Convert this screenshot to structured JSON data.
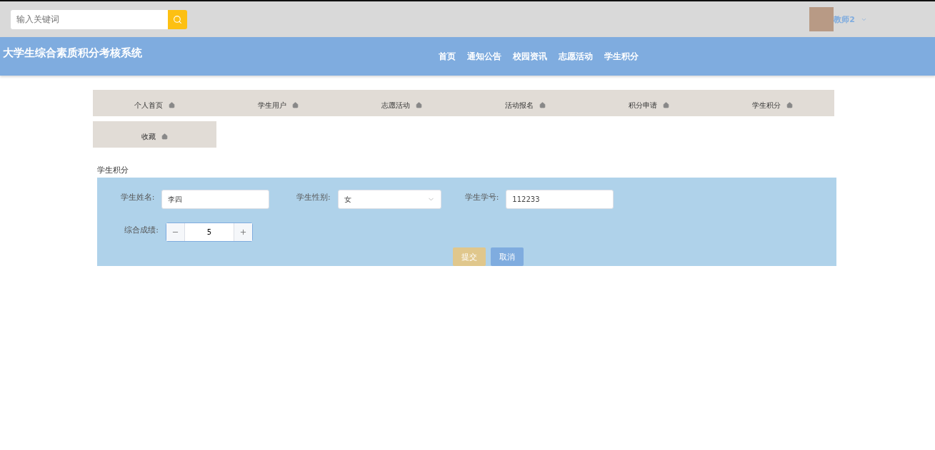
{
  "search": {
    "placeholder": "输入关键词"
  },
  "user": {
    "name": "教师2"
  },
  "header": {
    "title": "大学生综合素质积分考核系统",
    "nav": [
      "首页",
      "通知公告",
      "校园资讯",
      "志愿活动",
      "学生积分"
    ]
  },
  "menu": [
    "个人首页",
    "学生用户",
    "志愿活动",
    "活动报名",
    "积分申请",
    "学生积分",
    "收藏"
  ],
  "section_title": "学生积分",
  "form": {
    "fields": [
      {
        "kind": "text",
        "label": "学生姓名:",
        "value": "李四"
      },
      {
        "kind": "select",
        "label": "学生性别:",
        "value": "女"
      },
      {
        "kind": "text",
        "label": "学生学号:",
        "value": "112233"
      },
      {
        "kind": "number",
        "label": "综合成绩:",
        "value": "5"
      }
    ],
    "buttons": [
      {
        "kind": "submit",
        "label": "提交"
      },
      {
        "kind": "cancel",
        "label": "取消"
      }
    ]
  }
}
